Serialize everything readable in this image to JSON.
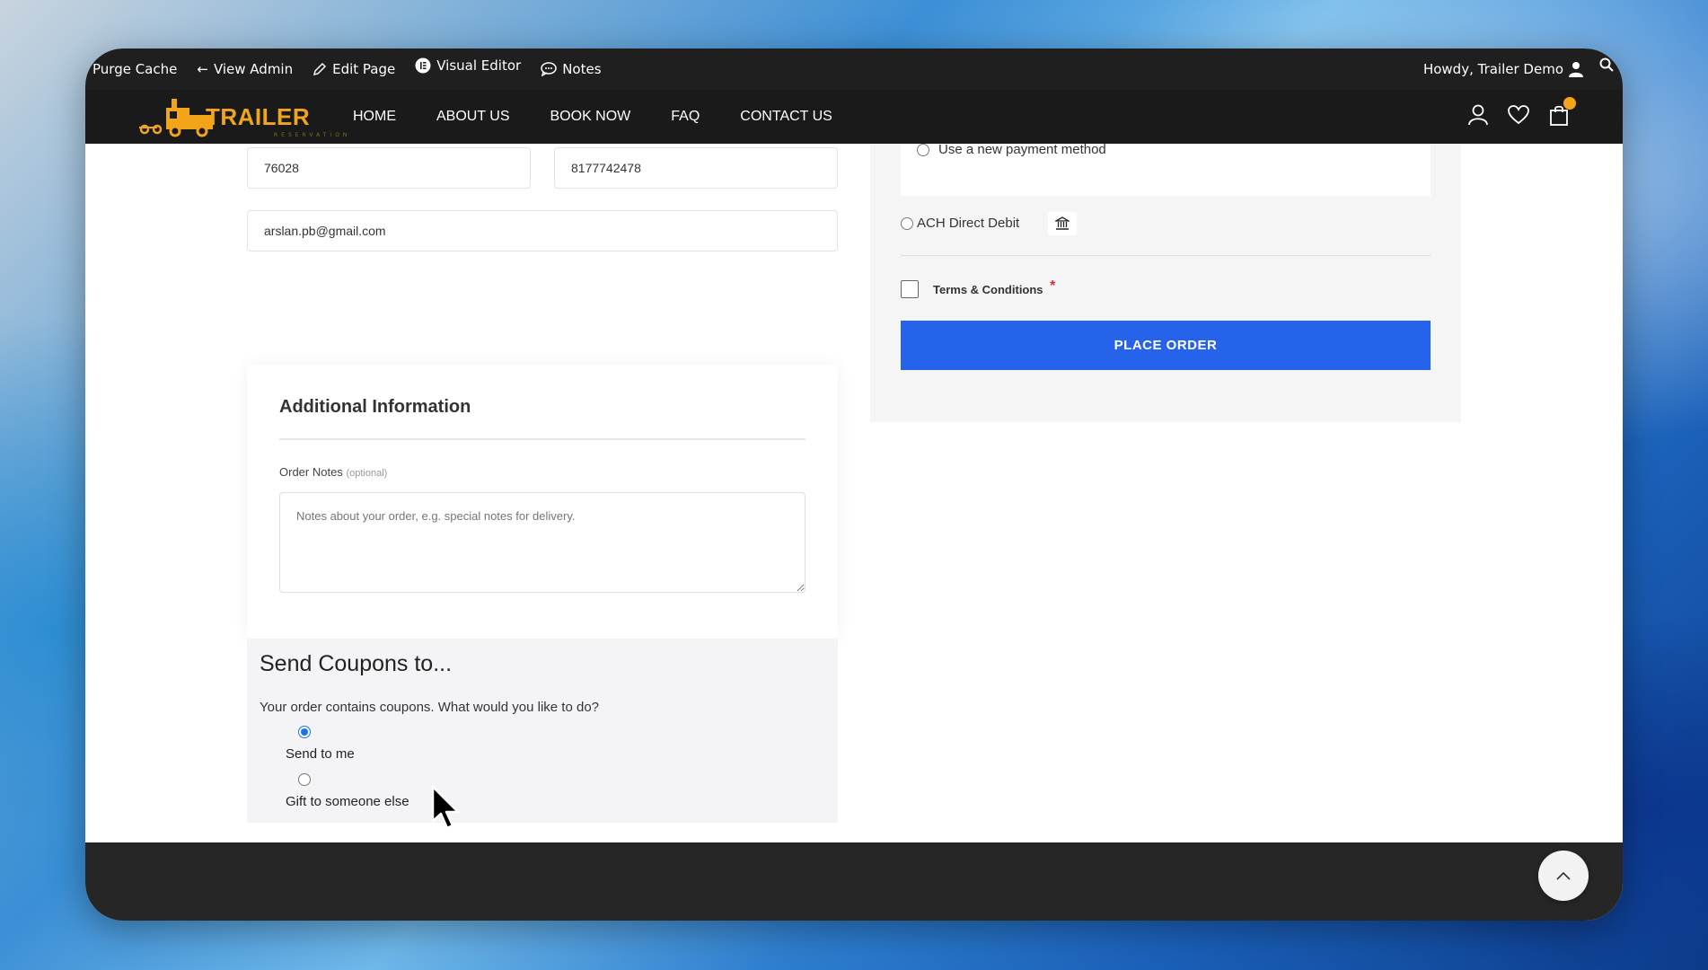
{
  "adminbar": {
    "purge_cache": "Purge Cache",
    "view_admin": "View Admin",
    "edit_page": "Edit Page",
    "visual_editor": "Visual Editor",
    "notes": "Notes",
    "howdy": "Howdy, Trailer Demo"
  },
  "header": {
    "logo_text": "TRAILER",
    "logo_sub": "RESERVATION",
    "nav": [
      "HOME",
      "ABOUT US",
      "BOOK NOW",
      "FAQ",
      "CONTACT US"
    ]
  },
  "billing": {
    "zip": "76028",
    "phone": "8177742478",
    "email": "arslan.pb@gmail.com"
  },
  "additional": {
    "title": "Additional Information",
    "notes_label": "Order Notes",
    "notes_optional": "(optional)",
    "notes_placeholder": "Notes about your order, e.g. special notes for delivery."
  },
  "coupons": {
    "title": "Send Coupons to...",
    "question": "Your order contains coupons. What would you like to do?",
    "options": [
      {
        "label": "Send to me",
        "selected": true
      },
      {
        "label": "Gift to someone else",
        "selected": false
      }
    ]
  },
  "payment": {
    "new_method": "Use a new payment method",
    "ach": "ACH Direct Debit",
    "terms": "Terms & Conditions",
    "required_mark": "*",
    "place_order": "PLACE ORDER"
  },
  "colors": {
    "accent": "#2563eb",
    "brand": "#f3a51a",
    "required": "#d32f2f"
  }
}
